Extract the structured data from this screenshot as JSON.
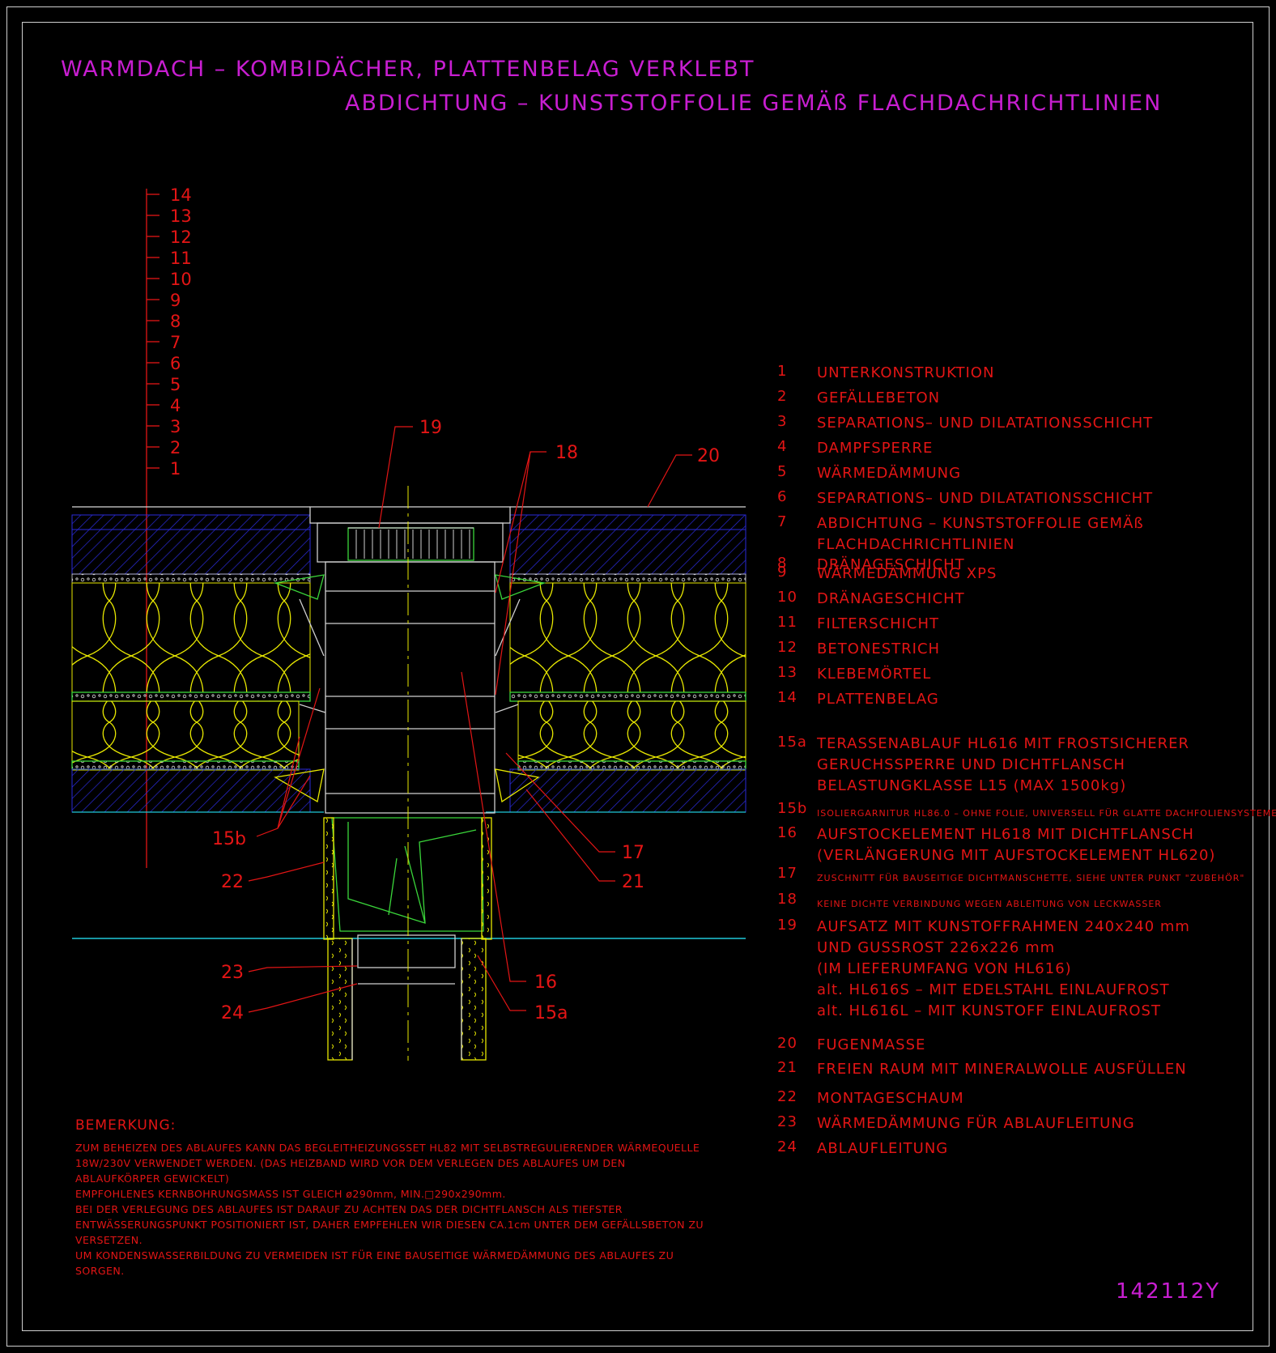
{
  "title": {
    "line1": "WARMDACH – KOMBIDÄCHER, PLATTENBELAG VERKLEBT",
    "line2": "ABDICHTUNG – KUNSTSTOFFOLIE GEMÄß FLACHDACHRICHTLINIEN"
  },
  "layer_scale": [
    "14",
    "13",
    "12",
    "11",
    "10",
    "9",
    "8",
    "7",
    "6",
    "5",
    "4",
    "3",
    "2",
    "1"
  ],
  "callouts": {
    "c19": "19",
    "c18": "18",
    "c20": "20",
    "c17": "17",
    "c21": "21",
    "c15b": "15b",
    "c22": "22",
    "c23": "23",
    "c24": "24",
    "c16": "16",
    "c15a": "15a"
  },
  "legend": [
    {
      "num": "1",
      "text": "UNTERKONSTRUKTION"
    },
    {
      "num": "2",
      "text": "GEFÄLLEBETON"
    },
    {
      "num": "3",
      "text": "SEPARATIONS– UND DILATATIONSSCHICHT"
    },
    {
      "num": "4",
      "text": "DAMPFSPERRE"
    },
    {
      "num": "5",
      "text": "WÄRMEDÄMMUNG"
    },
    {
      "num": "6",
      "text": "SEPARATIONS– UND DILATATIONSSCHICHT"
    },
    {
      "num": "7",
      "text": "ABDICHTUNG – KUNSTSTOFFOLIE GEMÄß\nFLACHDACHRICHTLINIEN"
    },
    {
      "num": "8",
      "text": "DRÄNAGESCHICHT"
    },
    {
      "num": "9",
      "text": "WÄRMEDÄMMUNG XPS"
    },
    {
      "num": "10",
      "text": "DRÄNAGESCHICHT"
    },
    {
      "num": "11",
      "text": "FILTERSCHICHT"
    },
    {
      "num": "12",
      "text": "BETONESTRICH"
    },
    {
      "num": "13",
      "text": "KLEBEMÖRTEL"
    },
    {
      "num": "14",
      "text": "PLATTENBELAG"
    },
    {
      "num": "15a",
      "text": "TERASSENABLAUF HL616 MIT FROSTSICHERER\nGERUCHSSPERRE UND DICHTFLANSCH\nBELASTUNGKLASSE L15 (MAX 1500kg)"
    },
    {
      "num": "15b",
      "text": "ISOLIERGARNITUR HL86.0 – OHNE FOLIE, UNIVERSELL FÜR GLATTE DACHFOLIENSYSTEME."
    },
    {
      "num": "16",
      "text": "AUFSTOCKELEMENT HL618 MIT DICHTFLANSCH\n(VERLÄNGERUNG MIT AUFSTOCKELEMENT HL620)"
    },
    {
      "num": "17",
      "text": "ZUSCHNITT FÜR BAUSEITIGE DICHTMANSCHETTE, SIEHE UNTER PUNKT \"ZUBEHÖR\""
    },
    {
      "num": "18",
      "text": "KEINE DICHTE VERBINDUNG WEGEN ABLEITUNG VON LECKWASSER"
    },
    {
      "num": "19",
      "text": "AUFSATZ MIT KUNSTOFFRAHMEN 240x240 mm\nUND GUSSROST 226x226 mm\n(IM LIEFERUMFANG VON HL616)\nalt. HL616S – MIT EDELSTAHL EINLAUFROST\nalt. HL616L – MIT KUNSTOFF EINLAUFROST"
    },
    {
      "num": "20",
      "text": "FUGENMASSE"
    },
    {
      "num": "21",
      "text": "FREIEN RAUM MIT MINERALWOLLE AUSFÜLLEN"
    },
    {
      "num": "22",
      "text": "MONTAGESCHAUM"
    },
    {
      "num": "23",
      "text": "WÄRMEDÄMMUNG FÜR ABLAUFLEITUNG"
    },
    {
      "num": "24",
      "text": "ABLAUFLEITUNG"
    }
  ],
  "remark": {
    "title": "BEMERKUNG:",
    "body": "ZUM BEHEIZEN DES ABLAUFES KANN DAS BEGLEITHEIZUNGSSET HL82 MIT SELBSTREGULIERENDER WÄRMEQUELLE\n18W/230V VERWENDET WERDEN. (DAS HEIZBAND WIRD VOR DEM VERLEGEN DES ABLAUFES UM DEN\nABLAUFKÖRPER GEWICKELT)\nEMPFOHLENES KERNBOHRUNGSMASS IST GLEICH ø290mm, MIN.□290x290mm.\nBEI DER VERLEGUNG DES ABLAUFES IST DARAUF ZU ACHTEN DAS DER DICHTFLANSCH ALS TIEFSTER\nENTWÄSSERUNGSPUNKT POSITIONIERT IST, DAHER EMPFEHLEN WIR DIESEN CA.1cm UNTER DEM GEFÄLLSBETON ZU\nVERSETZEN.\nUM KONDENSWASSERBILDUNG ZU VERMEIDEN IST FÜR EINE BAUSEITIGE WÄRMEDÄMMUNG DES ABLAUFES ZU\nSORGEN."
  },
  "doc_code": "142112Y",
  "colors": {
    "background": "#000000",
    "frame": "#cfcfcf",
    "title": "#c81ed1",
    "text": "#e31515",
    "insulation": "#e8e800",
    "screed": "#2a2ad8",
    "membrane": "#3ad63a",
    "drain": "#cfcfcf",
    "cyan_line": "#20c8d8"
  }
}
